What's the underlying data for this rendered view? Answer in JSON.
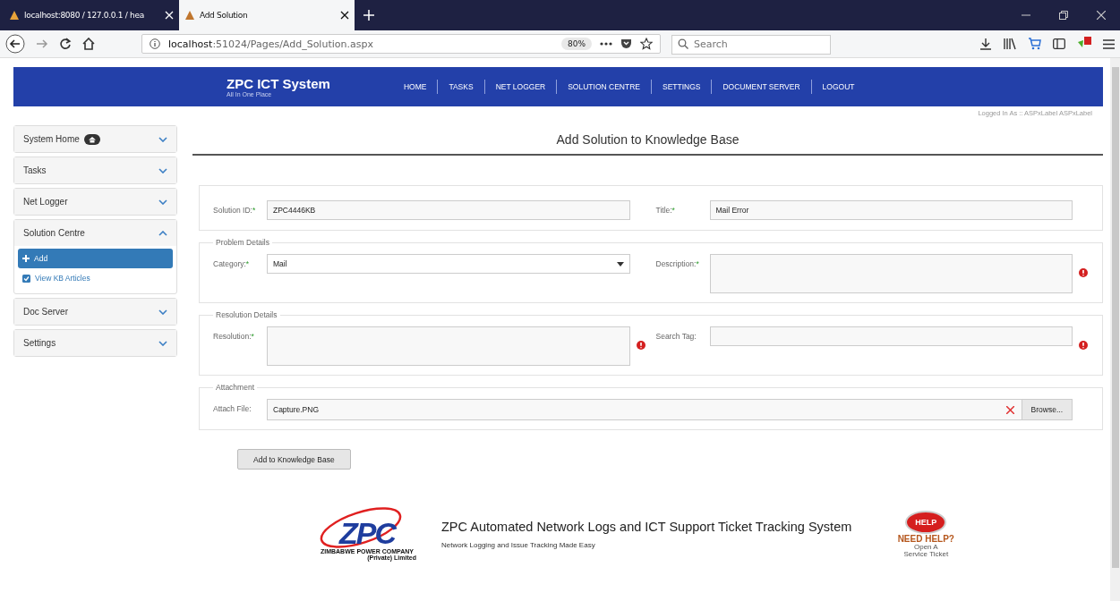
{
  "browser": {
    "tabs": [
      {
        "title": "localhost:8080 / 127.0.0.1 / hea",
        "selected": false
      },
      {
        "title": "Add Solution",
        "selected": true
      }
    ],
    "url_host": "localhost",
    "url_path": ":51024/Pages/Add_Solution.aspx",
    "zoom": "80%",
    "search": {
      "placeholder": "Search"
    }
  },
  "header": {
    "title": "ZPC ICT System",
    "subtitle": "All In One Place",
    "nav": [
      "HOME",
      "TASKS",
      "NET LOGGER",
      "SOLUTION CENTRE",
      "SETTINGS",
      "DOCUMENT SERVER",
      "LOGOUT"
    ],
    "logged_in": "Logged In As :: ASPxLabel ASPxLabel"
  },
  "sidebar": {
    "items": [
      {
        "label": "System Home",
        "kind": "home",
        "expanded": false
      },
      {
        "label": "Tasks",
        "kind": "plain",
        "expanded": false
      },
      {
        "label": "Net Logger",
        "kind": "plain",
        "expanded": false
      },
      {
        "label": "Solution Centre",
        "kind": "plain",
        "expanded": true,
        "children": [
          {
            "label": "Add",
            "kind": "plus",
            "selected": true
          },
          {
            "label": "View KB Articles",
            "kind": "check",
            "selected": false
          }
        ]
      },
      {
        "label": "Doc Server",
        "kind": "plain",
        "expanded": false
      },
      {
        "label": "Settings",
        "kind": "plain",
        "expanded": false
      }
    ]
  },
  "page_title": "Add Solution to Knowledge Base",
  "sections": [
    {
      "fields": [
        {
          "label": "Solution ID:",
          "marker": "*",
          "kind": "text",
          "value": "ZPC4446KB",
          "error": false
        },
        {
          "label": "Title:",
          "marker": "*",
          "kind": "text",
          "value": "Mail Error",
          "error": false
        }
      ]
    },
    {
      "legend": "Problem Details",
      "fields": [
        {
          "label": "Category:",
          "marker": "*",
          "kind": "select",
          "value": "Mail",
          "error": false
        },
        {
          "label": "Description:",
          "marker": "*",
          "kind": "textarea",
          "error": true
        }
      ]
    },
    {
      "legend": "Resolution Details",
      "fields": [
        {
          "label": "Resolution:",
          "marker": "*",
          "kind": "textarea",
          "error": true
        },
        {
          "label": "Search Tag:",
          "kind": "text",
          "error": true
        }
      ]
    },
    {
      "legend": "Attachment",
      "fields": [
        {
          "label": "Attach File:",
          "kind": "file",
          "value": "Capture.PNG",
          "button": "Browse...",
          "error": false
        }
      ]
    }
  ],
  "submit": "Add to Knowledge Base",
  "footer": {
    "logo_letters": "ZPC",
    "logo_name": "ZIMBABWE POWER COMPANY",
    "logo_sub": "(Private) Limited",
    "title": "ZPC Automated Network Logs and ICT Support Ticket Tracking System",
    "subtitle": "Network Logging and Issue Tracking Made Easy",
    "help_badge": "HELP",
    "help_title": "NEED HELP?",
    "help_line1": "Open A",
    "help_line2": "Service Ticket"
  }
}
